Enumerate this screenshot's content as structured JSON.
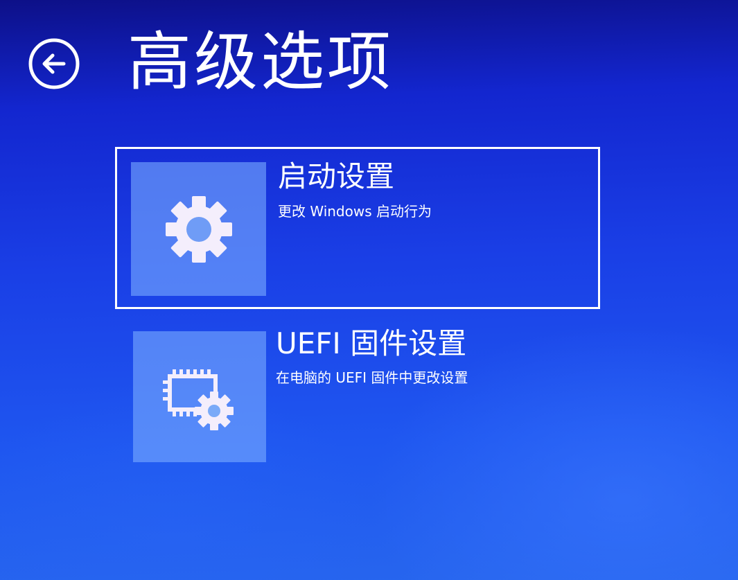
{
  "header": {
    "back_icon": "back-arrow-circle-icon",
    "title": "高级选项"
  },
  "options": [
    {
      "icon": "gear-icon",
      "title": "启动设置",
      "description": "更改 Windows 启动行为",
      "selected": true
    },
    {
      "icon": "firmware-chip-gear-icon",
      "title": "UEFI 固件设置",
      "description": "在电脑的 UEFI 固件中更改设置",
      "selected": false
    }
  ],
  "colors": {
    "background_top": "#0d1088",
    "background_bottom": "#2766ee",
    "tile": "#78aaff",
    "text": "#ffffff"
  }
}
